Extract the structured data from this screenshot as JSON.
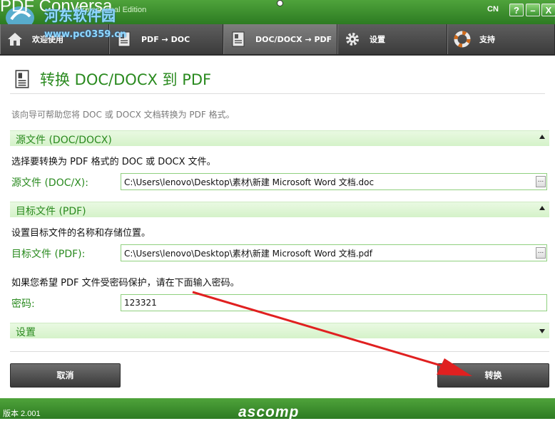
{
  "window": {
    "app_title": "PDF Conversa",
    "app_subtitle": "Professional Edition",
    "watermark_site": "河东软件园",
    "watermark_url": "www.pc0359.cn",
    "language": "CN",
    "help_label": "?",
    "minimize_label": "–",
    "close_label": "X"
  },
  "tabs": [
    {
      "label": "欢迎使用"
    },
    {
      "label": "PDF → DOC"
    },
    {
      "label": "DOC/DOCX → PDF"
    },
    {
      "label": "设置"
    },
    {
      "label": "支持"
    }
  ],
  "page": {
    "title": "转换 DOC/DOCX 到 PDF",
    "intro": "该向导可帮助您将 DOC 或 DOCX 文档转换为 PDF 格式。"
  },
  "source": {
    "section_title": "源文件 (DOC/DOCX)",
    "description": "选择要转换为 PDF 格式的 DOC 或 DOCX 文件。",
    "label": "源文件 (DOC/X):",
    "value": "C:\\Users\\lenovo\\Desktop\\素材\\新建 Microsoft Word 文档.doc",
    "browse_label": "..."
  },
  "target": {
    "section_title": "目标文件 (PDF)",
    "description": "设置目标文件的名称和存储位置。",
    "label": "目标文件 (PDF):",
    "value": "C:\\Users\\lenovo\\Desktop\\素材\\新建 Microsoft Word 文档.pdf",
    "browse_label": "..."
  },
  "password": {
    "description": "如果您希望 PDF 文件受密码保护，请在下面输入密码。",
    "label": "密码:",
    "value": "123321"
  },
  "settings_section": {
    "title": "设置"
  },
  "buttons": {
    "cancel": "取消",
    "convert": "转换"
  },
  "footer": {
    "version": "版本 2.001",
    "brand": "ascomp"
  },
  "colors": {
    "accent_green": "#2a8a1f",
    "header_green": "#3c9530",
    "annotation_red": "#e02020"
  }
}
